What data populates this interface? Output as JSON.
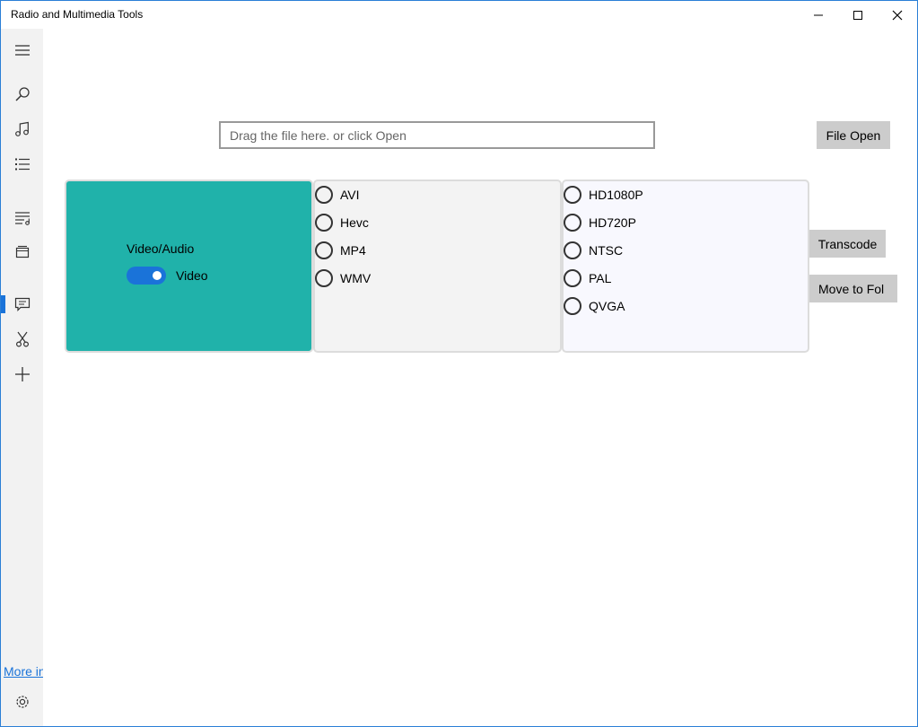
{
  "window": {
    "title": "Radio and Multimedia Tools"
  },
  "sidebar": {
    "items": [
      {
        "icon": "hamburger-icon"
      },
      {
        "icon": "search-icon"
      },
      {
        "icon": "music-note-icon"
      },
      {
        "icon": "list-icon"
      },
      {
        "icon": "playlist-icon"
      },
      {
        "icon": "video-library-icon"
      },
      {
        "icon": "message-icon",
        "selected": true
      },
      {
        "icon": "scissors-icon"
      },
      {
        "icon": "plus-icon"
      }
    ],
    "more_link": "More info",
    "settings_icon": "gear-icon"
  },
  "main": {
    "drop_placeholder": "Drag the file here. or click Open",
    "file_open_label": "File Open",
    "transcode_label": "Transcode",
    "move_label": "Move to Fol",
    "toggle": {
      "header": "Video/Audio",
      "label": "Video",
      "on": true
    },
    "codecs": [
      "AVI",
      "Hevc",
      "MP4",
      "WMV"
    ],
    "resolutions": [
      "HD1080P",
      "HD720P",
      "NTSC",
      "PAL",
      "QVGA"
    ]
  },
  "colors": {
    "accent": "#1a73d9",
    "teal_panel": "#20b2aa",
    "button_bg": "#cccccc"
  }
}
